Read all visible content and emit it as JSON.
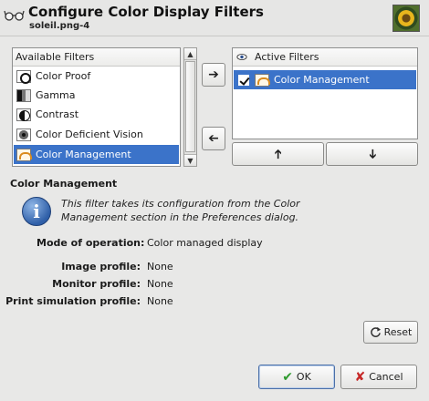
{
  "header": {
    "title": "Configure Color Display Filters",
    "subtitle": "soleil.png-4"
  },
  "available": {
    "header": "Available Filters",
    "items": [
      "Color Proof",
      "Gamma",
      "Contrast",
      "Color Deficient Vision",
      "Color Management"
    ],
    "selected": "Color Management"
  },
  "active": {
    "header": "Active Filters",
    "items": [
      {
        "label": "Color Management",
        "checked": true
      }
    ]
  },
  "details": {
    "title": "Color Management",
    "info": "This filter takes its configuration from the Color Management section in the Preferences dialog.",
    "mode_label": "Mode of operation:",
    "mode_value": "Color managed display",
    "image_profile_label": "Image profile:",
    "image_profile_value": "None",
    "monitor_profile_label": "Monitor profile:",
    "monitor_profile_value": "None",
    "print_profile_label": "Print simulation profile:",
    "print_profile_value": "None"
  },
  "buttons": {
    "reset": "Reset",
    "ok": "OK",
    "cancel": "Cancel"
  },
  "colors": {
    "selection": "#3b73c9",
    "ok_check": "#2f9a2f",
    "cancel_x": "#c62828"
  }
}
